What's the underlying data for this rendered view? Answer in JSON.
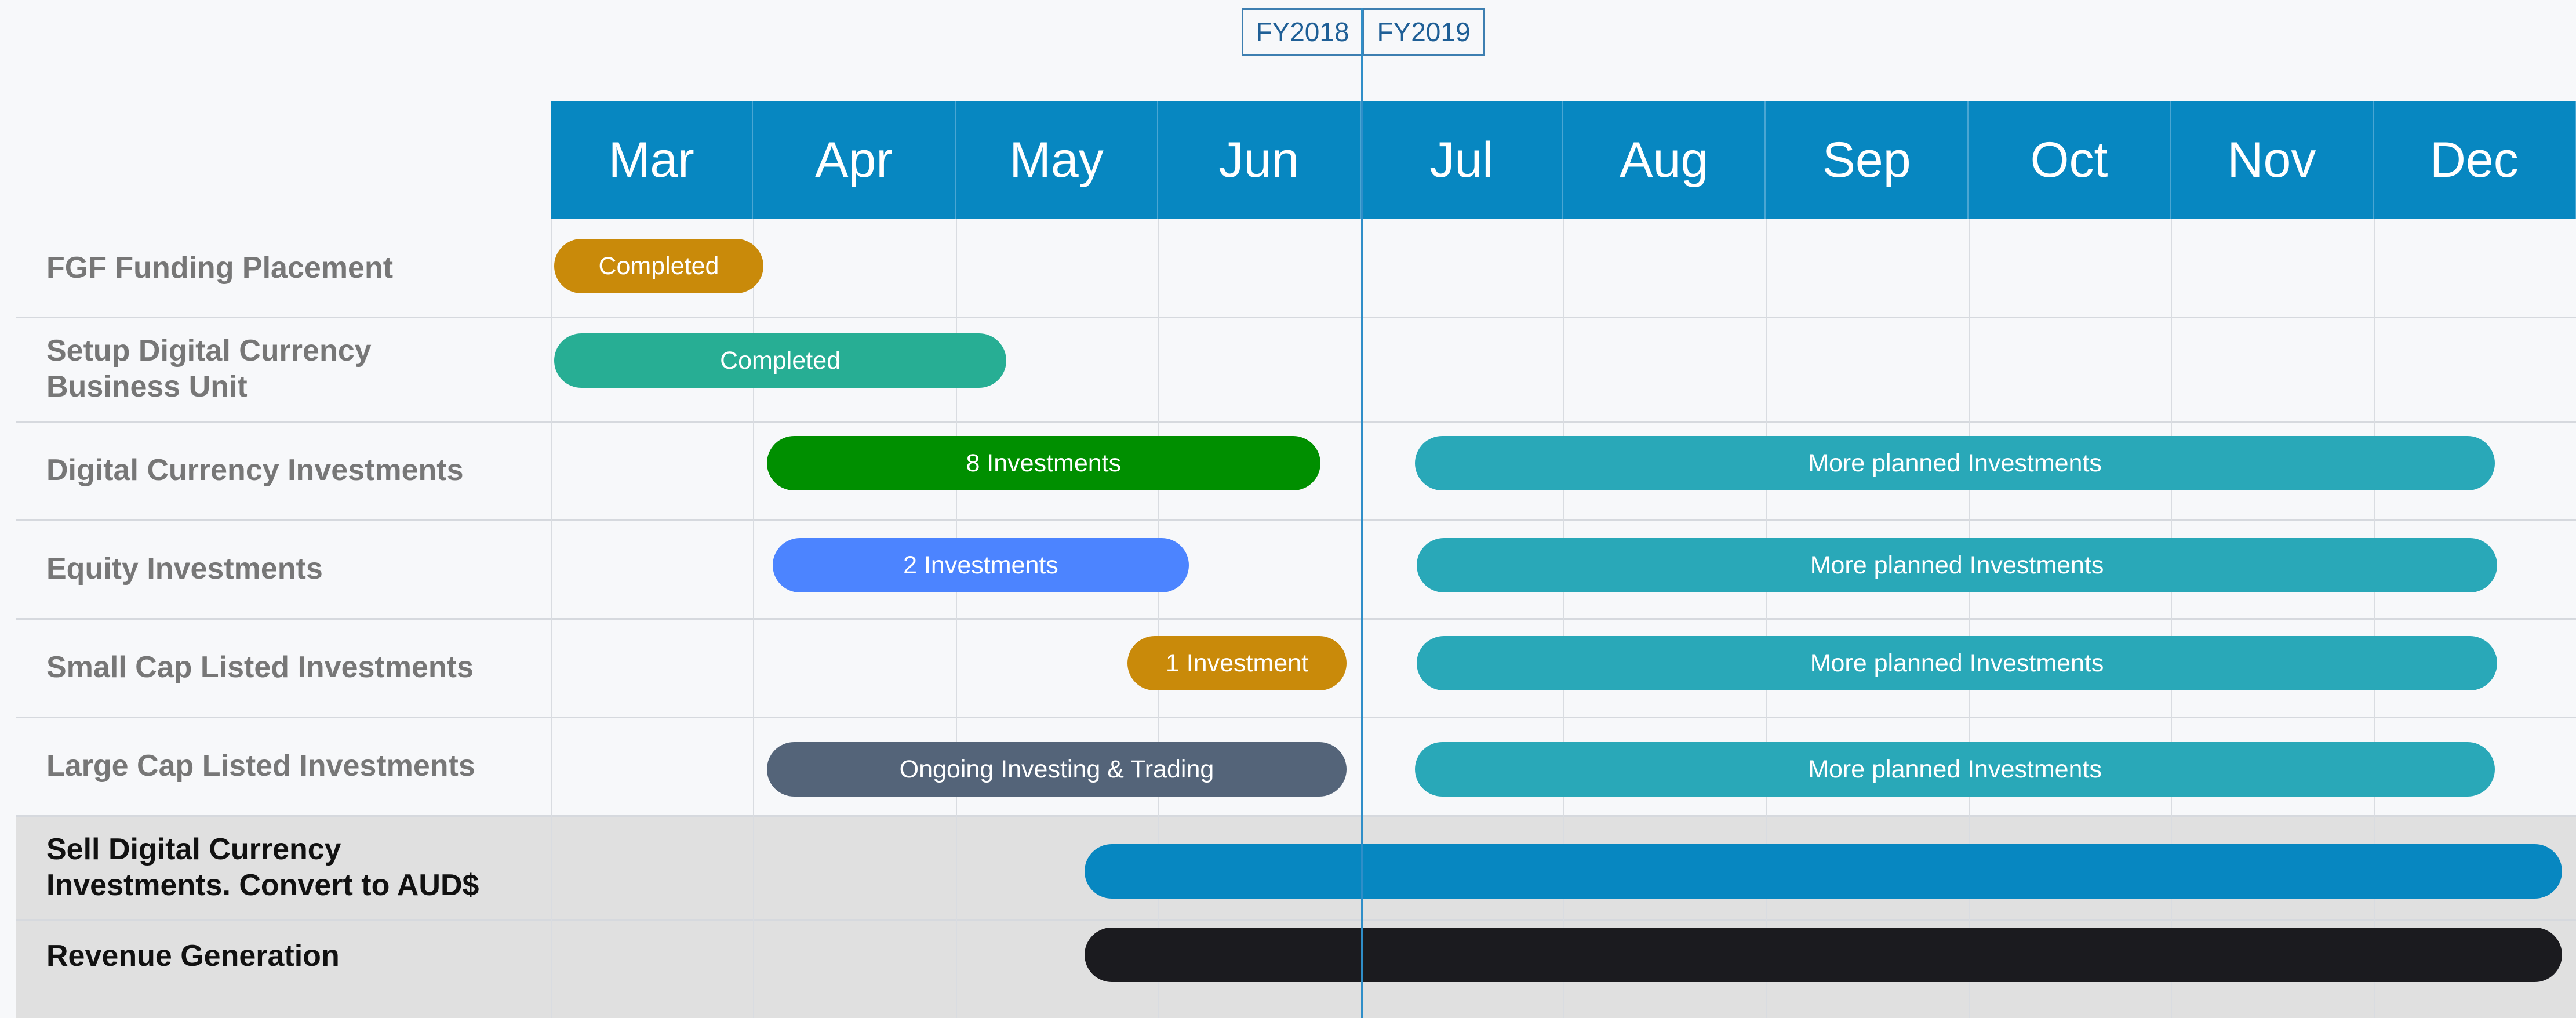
{
  "fiscal_years": {
    "left": "FY2018",
    "right": "FY2019"
  },
  "months": [
    "Mar",
    "Apr",
    "May",
    "Jun",
    "Jul",
    "Aug",
    "Sep",
    "Oct",
    "Nov",
    "Dec"
  ],
  "rows": [
    {
      "label_lines": [
        "FGF Funding Placement"
      ]
    },
    {
      "label_lines": [
        "Setup Digital Currency",
        "Business Unit"
      ]
    },
    {
      "label_lines": [
        "Digital Currency Investments"
      ]
    },
    {
      "label_lines": [
        "Equity Investments"
      ]
    },
    {
      "label_lines": [
        "Small Cap Listed Investments"
      ]
    },
    {
      "label_lines": [
        "Large Cap Listed Investments"
      ]
    },
    {
      "label_lines": [
        "Sell Digital Currency",
        "Investments. Convert to AUD$"
      ]
    },
    {
      "label_lines": [
        "Revenue Generation"
      ]
    }
  ],
  "bars": [
    {
      "row": 0,
      "start": 0.0,
      "end": 1.05,
      "label": "Completed",
      "color": "#c98a0a"
    },
    {
      "row": 1,
      "start": 0.0,
      "end": 2.25,
      "label": "Completed",
      "color": "#27ae94"
    },
    {
      "row": 2,
      "start": 1.05,
      "end": 3.8,
      "label": "8 Investments",
      "color": "#008f00"
    },
    {
      "row": 2,
      "start": 4.25,
      "end": 9.6,
      "label": "More planned Investments",
      "color": "#29a8b8"
    },
    {
      "row": 3,
      "start": 1.08,
      "end": 3.15,
      "label": "2 Investments",
      "color": "#4c84ff"
    },
    {
      "row": 3,
      "start": 4.26,
      "end": 9.61,
      "label": "More planned Investments",
      "color": "#29a8b8"
    },
    {
      "row": 4,
      "start": 2.83,
      "end": 3.93,
      "label": "1 Investment",
      "color": "#c98a0a"
    },
    {
      "row": 4,
      "start": 4.26,
      "end": 9.61,
      "label": "More planned Investments",
      "color": "#29a8b8"
    },
    {
      "row": 5,
      "start": 1.05,
      "end": 3.93,
      "label": "Ongoing Investing & Trading",
      "color": "#546479"
    },
    {
      "row": 5,
      "start": 4.25,
      "end": 9.6,
      "label": "More planned Investments",
      "color": "#29a8b8"
    },
    {
      "row": 6,
      "start": 2.62,
      "end": 9.93,
      "label": "",
      "color": "#0787c1"
    },
    {
      "row": 7,
      "start": 2.62,
      "end": 9.93,
      "label": "",
      "color": "#1b1b1f"
    }
  ]
}
